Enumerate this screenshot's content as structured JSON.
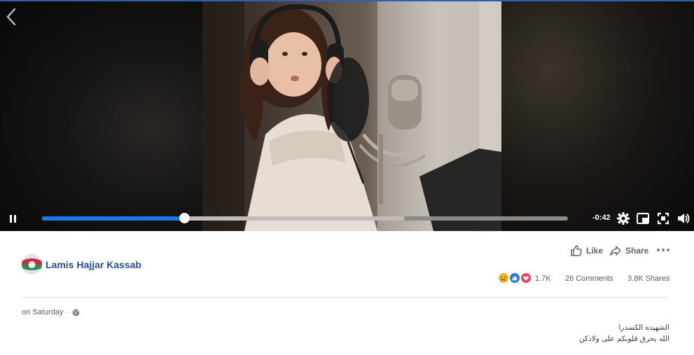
{
  "video": {
    "time_remaining": "-0:42",
    "progress_played": 0.27,
    "progress_buffered": 0.69
  },
  "icons": {
    "back": "chevron-left-icon",
    "pause": "pause-icon",
    "settings": "gear-icon",
    "pip": "picture-in-picture-icon",
    "fullscreen": "fullscreen-icon",
    "volume": "volume-icon",
    "like": "thumbs-up-icon",
    "share": "share-icon",
    "more": "more-dots-icon",
    "privacy": "globe-icon"
  },
  "post": {
    "author": "Lamis Hajjar Kassab",
    "like_label": "Like",
    "share_label": "Share",
    "reaction_count": "1.7K",
    "comments": "26 Comments",
    "shares": "3.8K Shares",
    "timestamp": "on Saturday ·",
    "caption_line1": "الشهيده الكسدرا",
    "caption_line2": "الله يحرق قلوبكم على ولادكن"
  },
  "colors": {
    "accent": "#1877f2",
    "author": "#2b4f8f",
    "reaction_sad": "#f7b125",
    "reaction_like": "#1877f2",
    "reaction_love": "#f33e58"
  }
}
